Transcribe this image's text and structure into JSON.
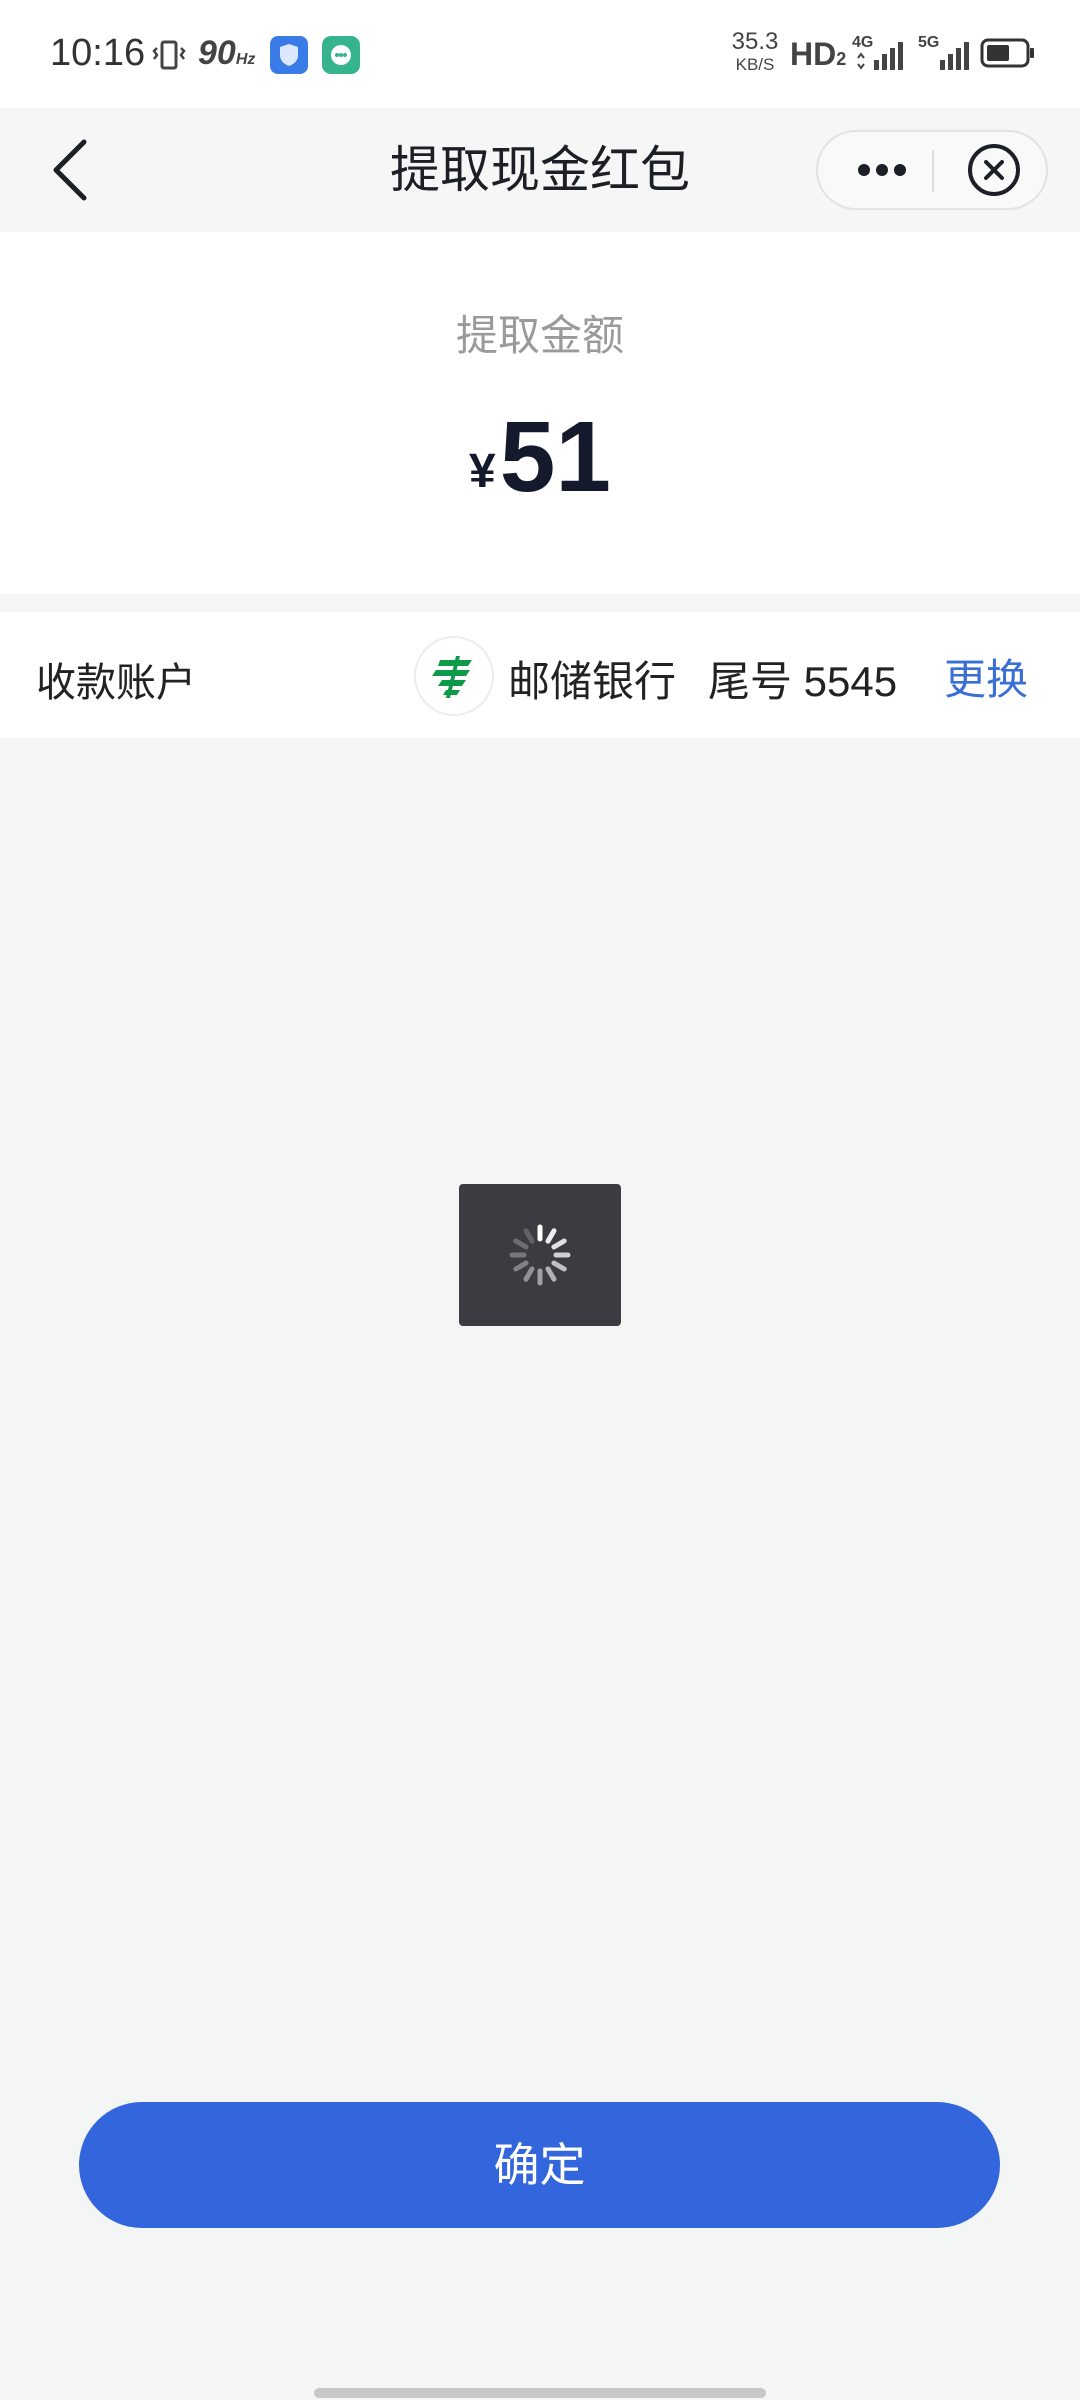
{
  "status_bar": {
    "time": "10:16",
    "refresh_rate": "90",
    "refresh_unit": "Hz",
    "net_speed_value": "35.3",
    "net_speed_unit": "KB/S",
    "hd_label": "HD",
    "hd_sub": "2",
    "network_1": "4G",
    "network_2": "5G",
    "icons": [
      "vibrate-icon",
      "security-shield-icon",
      "app-notification-icon",
      "signal-icon",
      "signal-icon",
      "battery-icon"
    ]
  },
  "nav": {
    "title": "提取现金红包",
    "icons": [
      "back-arrow-icon",
      "more-dots-icon",
      "close-circle-icon"
    ]
  },
  "amount": {
    "label": "提取金额",
    "currency": "¥",
    "value": "51"
  },
  "account": {
    "label": "收款账户",
    "bank_name": "邮储银行",
    "tail_number": "尾号 5545",
    "change_label": "更换",
    "bank_logo_icon": "postal-savings-bank-logo-icon"
  },
  "loading": {
    "icon": "loading-spinner-icon"
  },
  "confirm_button": {
    "label": "确定"
  },
  "colors": {
    "primary": "#3366dd",
    "link": "#3a6fd6",
    "background": "#f4f5f5",
    "bank_green": "#0f9a4a",
    "toast_bg": "#3b3c42"
  }
}
